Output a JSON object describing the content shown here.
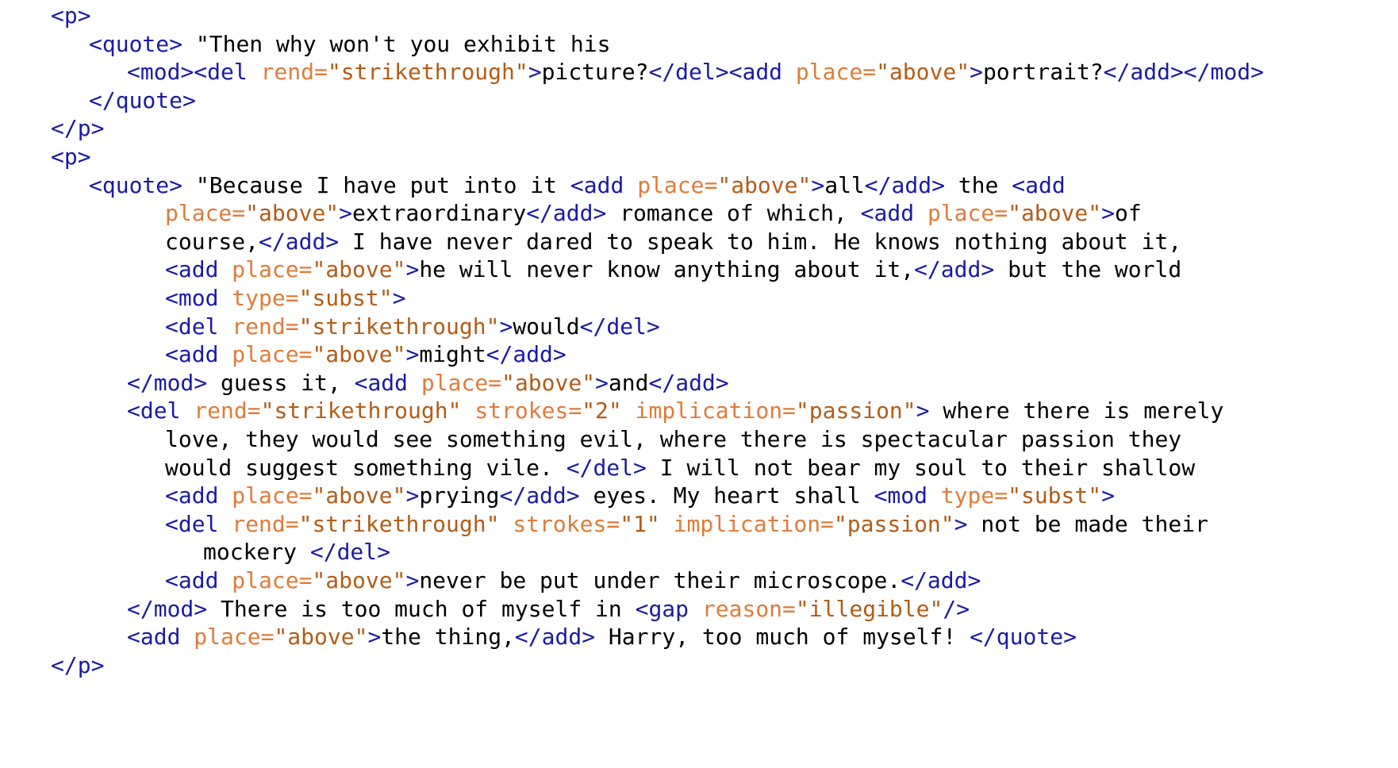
{
  "colors": {
    "tag": "#1a1aa6",
    "attribute": "#e07b39",
    "value": "#b35c17",
    "text": "#000000",
    "background": "#ffffff"
  },
  "lines": [
    {
      "indent": 0,
      "tokens": [
        [
          "tag",
          "<p>"
        ]
      ]
    },
    {
      "indent": 1,
      "tokens": [
        [
          "tag",
          "<quote>"
        ],
        [
          "txt",
          " \"Then why won't you exhibit his"
        ]
      ]
    },
    {
      "indent": 2,
      "tokens": [
        [
          "tag",
          "<mod><del "
        ],
        [
          "attr",
          "rend="
        ],
        [
          "val",
          "\"strikethrough\""
        ],
        [
          "tag",
          ">"
        ],
        [
          "txt",
          "picture?"
        ],
        [
          "tag",
          "</del><add "
        ],
        [
          "attr",
          "place="
        ],
        [
          "val",
          "\"above\""
        ],
        [
          "tag",
          ">"
        ],
        [
          "txt",
          "portrait?"
        ],
        [
          "tag",
          "</add></mod>"
        ]
      ]
    },
    {
      "indent": 1,
      "tokens": [
        [
          "tag",
          "</quote>"
        ]
      ]
    },
    {
      "indent": 0,
      "tokens": [
        [
          "tag",
          "</p>"
        ]
      ]
    },
    {
      "indent": 0,
      "tokens": [
        [
          "tag",
          "<p>"
        ]
      ]
    },
    {
      "indent": 1,
      "tokens": [
        [
          "tag",
          "<quote>"
        ],
        [
          "txt",
          " \"Because I have put into it "
        ],
        [
          "tag",
          "<add "
        ],
        [
          "attr",
          "place="
        ],
        [
          "val",
          "\"above\""
        ],
        [
          "tag",
          ">"
        ],
        [
          "txt",
          "all"
        ],
        [
          "tag",
          "</add>"
        ],
        [
          "txt",
          " the "
        ],
        [
          "tag",
          "<add"
        ]
      ]
    },
    {
      "indent": 3,
      "tokens": [
        [
          "attr",
          "place="
        ],
        [
          "val",
          "\"above\""
        ],
        [
          "tag",
          ">"
        ],
        [
          "txt",
          "extraordinary"
        ],
        [
          "tag",
          "</add>"
        ],
        [
          "txt",
          " romance of which, "
        ],
        [
          "tag",
          "<add "
        ],
        [
          "attr",
          "place="
        ],
        [
          "val",
          "\"above\""
        ],
        [
          "tag",
          ">"
        ],
        [
          "txt",
          "of"
        ]
      ]
    },
    {
      "indent": 3,
      "tokens": [
        [
          "txt",
          "course,"
        ],
        [
          "tag",
          "</add>"
        ],
        [
          "txt",
          " I have never dared to speak to him. He knows nothing about it,"
        ]
      ]
    },
    {
      "indent": 3,
      "tokens": [
        [
          "tag",
          "<add "
        ],
        [
          "attr",
          "place="
        ],
        [
          "val",
          "\"above\""
        ],
        [
          "tag",
          ">"
        ],
        [
          "txt",
          "he will never know anything about it,"
        ],
        [
          "tag",
          "</add>"
        ],
        [
          "txt",
          " but the world"
        ]
      ]
    },
    {
      "indent": 3,
      "tokens": [
        [
          "tag",
          "<mod "
        ],
        [
          "attr",
          "type="
        ],
        [
          "val",
          "\"subst\""
        ],
        [
          "tag",
          ">"
        ]
      ]
    },
    {
      "indent": 3,
      "tokens": [
        [
          "tag",
          "<del "
        ],
        [
          "attr",
          "rend="
        ],
        [
          "val",
          "\"strikethrough\""
        ],
        [
          "tag",
          ">"
        ],
        [
          "txt",
          "would"
        ],
        [
          "tag",
          "</del>"
        ]
      ]
    },
    {
      "indent": 3,
      "tokens": [
        [
          "tag",
          "<add "
        ],
        [
          "attr",
          "place="
        ],
        [
          "val",
          "\"above\""
        ],
        [
          "tag",
          ">"
        ],
        [
          "txt",
          "might"
        ],
        [
          "tag",
          "</add>"
        ]
      ]
    },
    {
      "indent": 2,
      "tokens": [
        [
          "tag",
          "</mod>"
        ],
        [
          "txt",
          " guess it, "
        ],
        [
          "tag",
          "<add "
        ],
        [
          "attr",
          "place="
        ],
        [
          "val",
          "\"above\""
        ],
        [
          "tag",
          ">"
        ],
        [
          "txt",
          "and"
        ],
        [
          "tag",
          "</add>"
        ]
      ]
    },
    {
      "indent": 2,
      "tokens": [
        [
          "tag",
          "<del "
        ],
        [
          "attr",
          "rend="
        ],
        [
          "val",
          "\"strikethrough\""
        ],
        [
          "txt",
          " "
        ],
        [
          "attr",
          "strokes="
        ],
        [
          "val",
          "\"2\""
        ],
        [
          "txt",
          " "
        ],
        [
          "attr",
          "implication="
        ],
        [
          "val",
          "\"passion\""
        ],
        [
          "tag",
          ">"
        ],
        [
          "txt",
          " where there is merely"
        ]
      ]
    },
    {
      "indent": 3,
      "tokens": [
        [
          "txt",
          "love, they would see something evil, where there is spectacular passion they"
        ]
      ]
    },
    {
      "indent": 3,
      "tokens": [
        [
          "txt",
          "would suggest something vile. "
        ],
        [
          "tag",
          "</del>"
        ],
        [
          "txt",
          " I will not bear my soul to their shallow"
        ]
      ]
    },
    {
      "indent": 3,
      "tokens": [
        [
          "tag",
          "<add "
        ],
        [
          "attr",
          "place="
        ],
        [
          "val",
          "\"above\""
        ],
        [
          "tag",
          ">"
        ],
        [
          "txt",
          "prying"
        ],
        [
          "tag",
          "</add>"
        ],
        [
          "txt",
          " eyes. My heart shall "
        ],
        [
          "tag",
          "<mod "
        ],
        [
          "attr",
          "type="
        ],
        [
          "val",
          "\"subst\""
        ],
        [
          "tag",
          ">"
        ]
      ]
    },
    {
      "indent": 3,
      "tokens": [
        [
          "tag",
          "<del "
        ],
        [
          "attr",
          "rend="
        ],
        [
          "val",
          "\"strikethrough\""
        ],
        [
          "txt",
          " "
        ],
        [
          "attr",
          "strokes="
        ],
        [
          "val",
          "\"1\""
        ],
        [
          "txt",
          " "
        ],
        [
          "attr",
          "implication="
        ],
        [
          "val",
          "\"passion\""
        ],
        [
          "tag",
          ">"
        ],
        [
          "txt",
          " not be made their"
        ]
      ]
    },
    {
      "indent": 4,
      "tokens": [
        [
          "txt",
          "mockery "
        ],
        [
          "tag",
          "</del>"
        ]
      ]
    },
    {
      "indent": 3,
      "tokens": [
        [
          "tag",
          "<add "
        ],
        [
          "attr",
          "place="
        ],
        [
          "val",
          "\"above\""
        ],
        [
          "tag",
          ">"
        ],
        [
          "txt",
          "never be put under their microscope."
        ],
        [
          "tag",
          "</add>"
        ]
      ]
    },
    {
      "indent": 2,
      "tokens": [
        [
          "tag",
          "</mod>"
        ],
        [
          "txt",
          " There is too much of myself in "
        ],
        [
          "tag",
          "<gap "
        ],
        [
          "attr",
          "reason="
        ],
        [
          "val",
          "\"illegible\""
        ],
        [
          "tag",
          "/>"
        ]
      ]
    },
    {
      "indent": 2,
      "tokens": [
        [
          "tag",
          "<add "
        ],
        [
          "attr",
          "place="
        ],
        [
          "val",
          "\"above\""
        ],
        [
          "tag",
          ">"
        ],
        [
          "txt",
          "the thing,"
        ],
        [
          "tag",
          "</add>"
        ],
        [
          "txt",
          " Harry, too much of myself! "
        ],
        [
          "tag",
          "</quote>"
        ]
      ]
    },
    {
      "indent": 0,
      "tokens": [
        [
          "tag",
          "</p>"
        ]
      ]
    }
  ]
}
